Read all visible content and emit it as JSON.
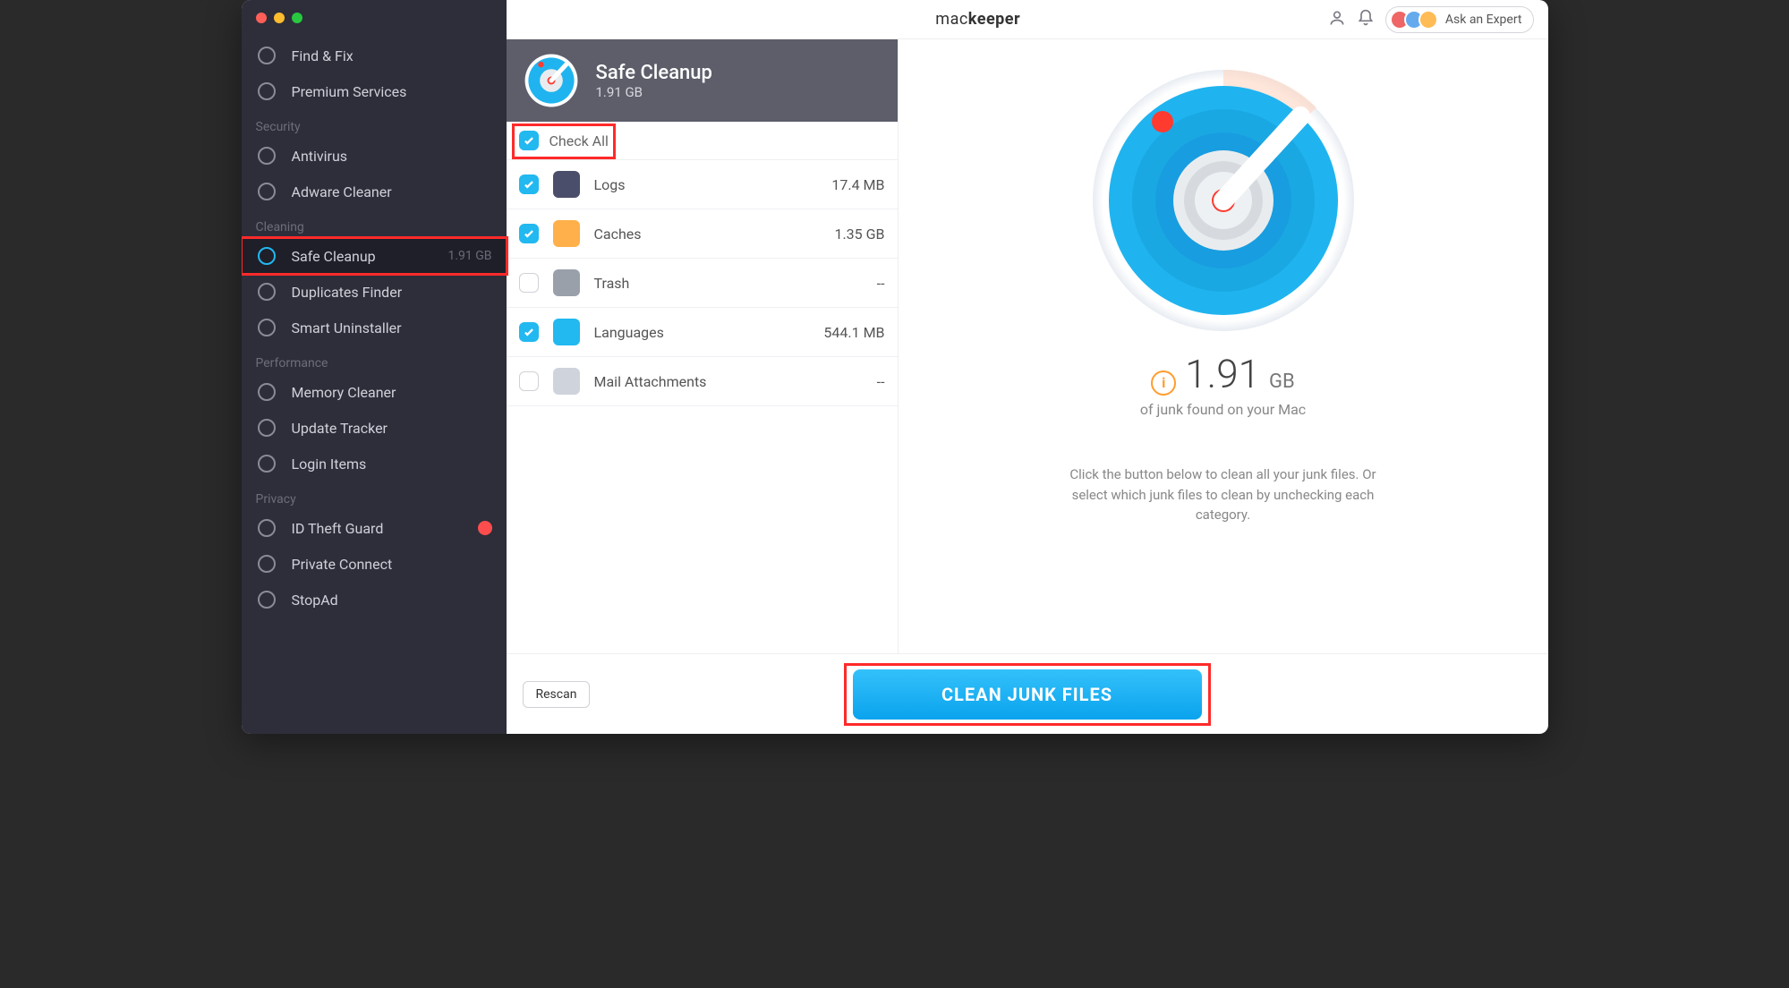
{
  "brand_prefix": "mac",
  "brand_suffix": "keeper",
  "expert_label": "Ask an Expert",
  "sidebar": {
    "top": [
      {
        "label": "Find & Fix"
      },
      {
        "label": "Premium Services"
      }
    ],
    "sections": [
      {
        "title": "Security",
        "items": [
          {
            "label": "Antivirus"
          },
          {
            "label": "Adware Cleaner"
          }
        ]
      },
      {
        "title": "Cleaning",
        "items": [
          {
            "label": "Safe Cleanup",
            "size": "1.91 GB",
            "active": true
          },
          {
            "label": "Duplicates Finder"
          },
          {
            "label": "Smart Uninstaller"
          }
        ]
      },
      {
        "title": "Performance",
        "items": [
          {
            "label": "Memory Cleaner"
          },
          {
            "label": "Update Tracker"
          },
          {
            "label": "Login Items"
          }
        ]
      },
      {
        "title": "Privacy",
        "items": [
          {
            "label": "ID Theft Guard",
            "alert": true
          },
          {
            "label": "Private Connect"
          },
          {
            "label": "StopAd"
          }
        ]
      }
    ]
  },
  "panel": {
    "title": "Safe Cleanup",
    "subtitle": "1.91 GB",
    "check_all": "Check All",
    "categories": [
      {
        "name": "Logs",
        "size": "17.4 MB",
        "checked": true,
        "color": "#4a4e6a"
      },
      {
        "name": "Caches",
        "size": "1.35 GB",
        "checked": true,
        "color": "#ffb04a"
      },
      {
        "name": "Trash",
        "size": "--",
        "checked": false,
        "color": "#9aa0aa"
      },
      {
        "name": "Languages",
        "size": "544.1 MB",
        "checked": true,
        "color": "#22b8f0"
      },
      {
        "name": "Mail Attachments",
        "size": "--",
        "checked": false,
        "color": "#cfd4dc"
      }
    ]
  },
  "result": {
    "amount": "1.91",
    "unit": "GB",
    "sub": "of junk found on your Mac",
    "help": "Click the button below to clean all your junk files. Or select which junk files to clean by unchecking each category."
  },
  "footer": {
    "rescan": "Rescan",
    "clean": "CLEAN JUNK FILES"
  }
}
